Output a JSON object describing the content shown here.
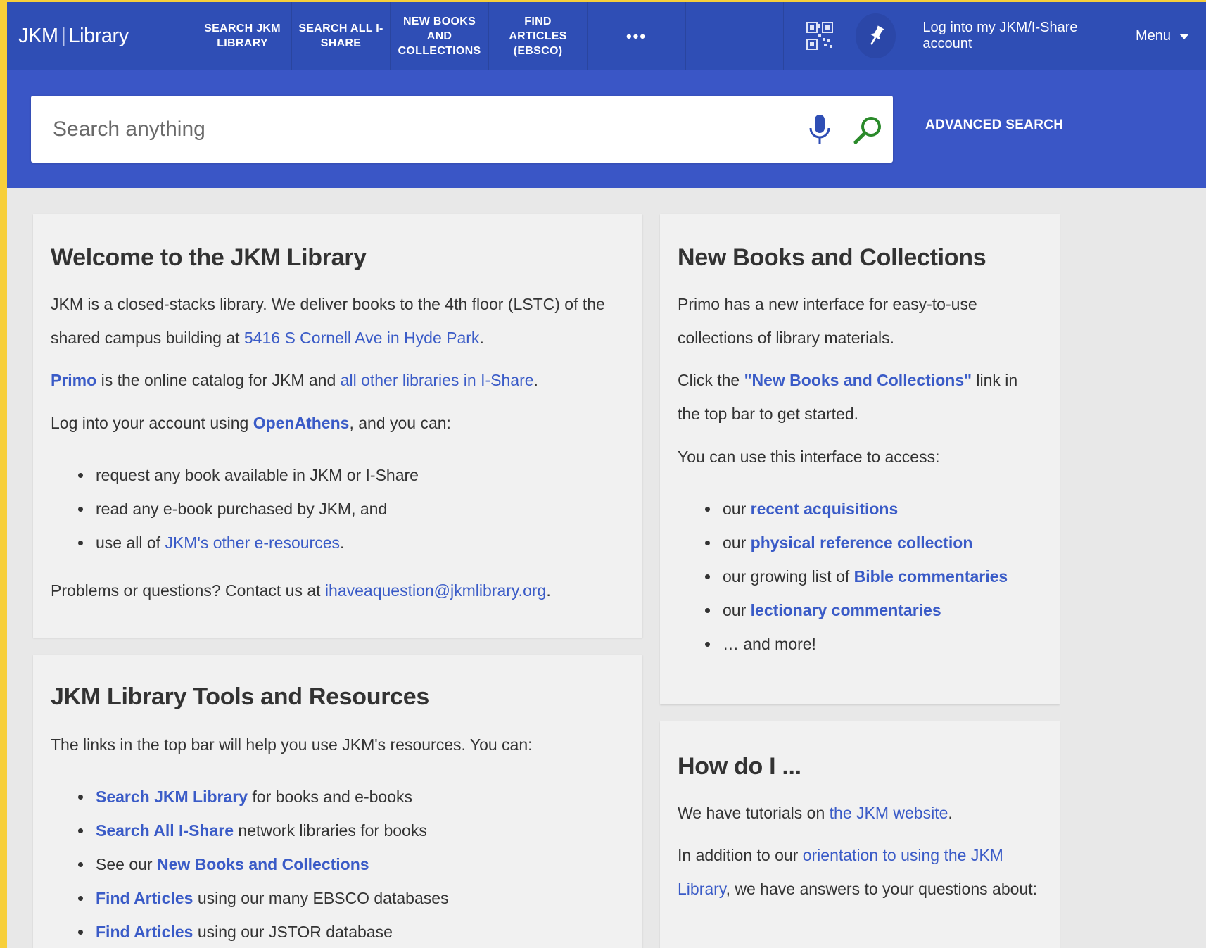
{
  "logo": {
    "left": "JKM",
    "sep": "|",
    "right": "Library"
  },
  "nav": [
    {
      "label": "SEARCH JKM LIBRARY"
    },
    {
      "label": "SEARCH ALL I-SHARE"
    },
    {
      "label": "NEW BOOKS AND COLLECTIONS"
    },
    {
      "label": "FIND ARTICLES (EBSCO)"
    },
    {
      "label": "•••"
    }
  ],
  "topright": {
    "login": "Log into my JKM/I-Share account",
    "menu": "Menu"
  },
  "search": {
    "placeholder": "Search anything",
    "advanced": "ADVANCED SEARCH"
  },
  "welcome": {
    "title": "Welcome to the JKM Library",
    "p1_a": "JKM is a closed-stacks library. We deliver books to the 4th floor (LSTC) of the shared campus building at ",
    "p1_link": "5416 S Cornell Ave in Hyde Park",
    "p1_end": ".",
    "p2_link1": "Primo",
    "p2_mid": " is the online catalog for JKM and ",
    "p2_link2": "all other libraries in I-Share",
    "p2_end": ".",
    "p3_a": "Log into your account using ",
    "p3_link": "OpenAthens",
    "p3_end": ", and you can:",
    "li1": "request any book available in JKM or I-Share",
    "li2": "read any e-book purchased by JKM, and",
    "li3_a": "use all of ",
    "li3_link": "JKM's other e-resources",
    "li3_end": ".",
    "p4_a": "Problems or questions? Contact us at ",
    "p4_link": "ihaveaquestion@jkmlibrary.org",
    "p4_end": "."
  },
  "tools": {
    "title": "JKM Library Tools and Resources",
    "intro": "The links in the top bar will help you use JKM's resources. You can:",
    "items": [
      {
        "link": "Search JKM Library",
        "text": " for books and e-books",
        "pre": ""
      },
      {
        "link": "Search All I-Share",
        "text": " network libraries for books",
        "pre": ""
      },
      {
        "pre": "See our ",
        "link": "New Books and Collections",
        "text": ""
      },
      {
        "link": "Find Articles",
        "text": " using our many EBSCO databases",
        "pre": ""
      },
      {
        "link": "Find Articles",
        "text": " using our JSTOR database",
        "pre": ""
      }
    ]
  },
  "newbooks": {
    "title": "New Books and Collections",
    "p1": "Primo has a new interface for easy-to-use collections of library materials.",
    "p2_a": "Click the ",
    "p2_link": "\"New Books and Collections\"",
    "p2_end": " link in the top bar to get started.",
    "p3": "You can use this interface to access:",
    "li1_a": "our ",
    "li1_link": "recent acquisitions",
    "li2_a": "our ",
    "li2_link": "physical reference collection",
    "li3_a": "our growing list of ",
    "li3_link": "Bible commentaries",
    "li4_a": "our ",
    "li4_link": "lectionary commentaries",
    "li5": "… and more!"
  },
  "howdoi": {
    "title": "How do I ...",
    "p1_a": "We have tutorials on ",
    "p1_link": "the JKM website",
    "p1_end": ".",
    "p2_a": "In addition to our ",
    "p2_link": "orientation to using the JKM Library",
    "p2_end": ", we have answers to your questions about:"
  },
  "colors": {
    "topbar": "#2f4eb5",
    "searchband": "#3a56c6",
    "link": "#3a5bc7",
    "frame": "#f7cf3a"
  }
}
